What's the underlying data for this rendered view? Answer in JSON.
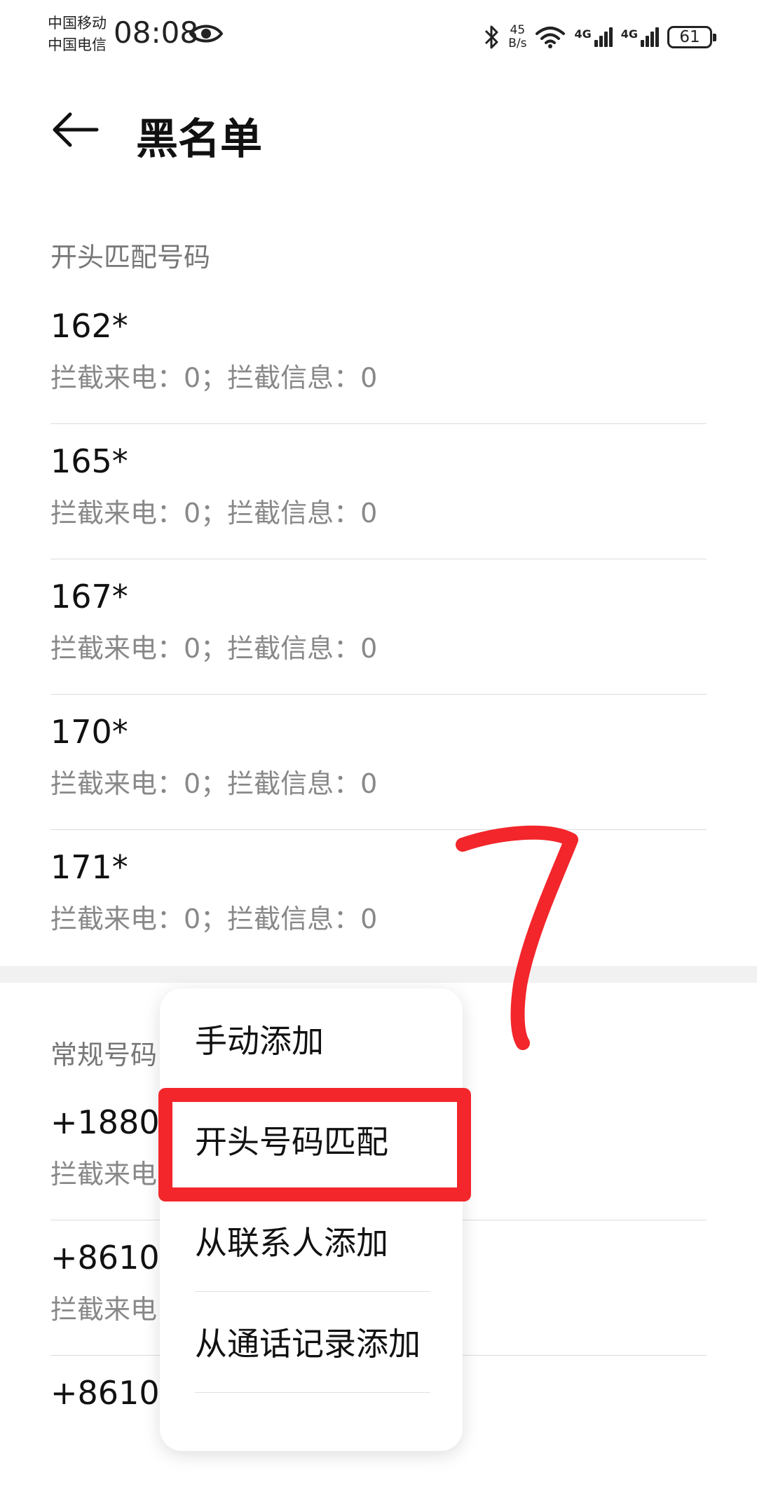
{
  "status_bar": {
    "carrier_1": "中国移动",
    "carrier_2": "中国电信",
    "time": "08:08",
    "net_speed_value": "45",
    "net_speed_unit": "B/s",
    "sim1_network": "4G",
    "sim2_network": "4G",
    "battery": "61"
  },
  "app_bar": {
    "title": "黑名单"
  },
  "sections": {
    "prefix": {
      "header": "开头匹配号码",
      "items": [
        {
          "number": "162*",
          "stats": "拦截来电：0；拦截信息：0"
        },
        {
          "number": "165*",
          "stats": "拦截来电：0；拦截信息：0"
        },
        {
          "number": "167*",
          "stats": "拦截来电：0；拦截信息：0"
        },
        {
          "number": "170*",
          "stats": "拦截来电：0；拦截信息：0"
        },
        {
          "number": "171*",
          "stats": "拦截来电：0；拦截信息：0"
        }
      ]
    },
    "regular": {
      "header": "常规号码",
      "items": [
        {
          "number": "+18803",
          "stats": "拦截来电"
        },
        {
          "number": "+86102",
          "stats": "拦截来电"
        },
        {
          "number": "+86105",
          "stats": ""
        }
      ]
    }
  },
  "popup_menu": {
    "items": [
      "手动添加",
      "开头号码匹配",
      "从联系人添加",
      "从通话记录添加"
    ]
  },
  "annotation": {
    "step_number": "7",
    "color": "#f2262b"
  }
}
